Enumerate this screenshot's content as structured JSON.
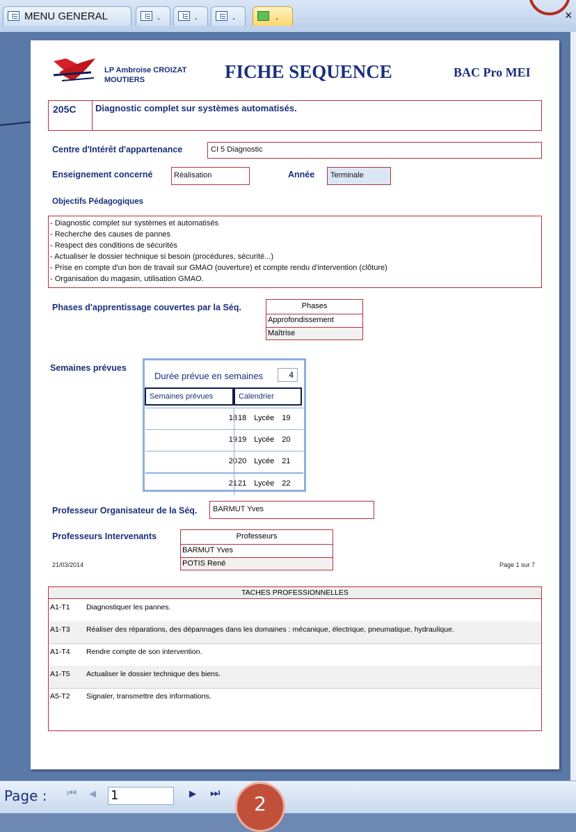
{
  "tabs": [
    {
      "label": "MENU GENERAL",
      "icon": "form-icon"
    },
    {
      "label": ".",
      "icon": "form-icon"
    },
    {
      "label": ".",
      "icon": "form-icon"
    },
    {
      "label": ".",
      "icon": "form-icon"
    },
    {
      "label": ".",
      "icon": "report-icon"
    }
  ],
  "close_glyph": "×",
  "report": {
    "school": "LP Ambroise CROIZAT",
    "town": "MOUTIERS",
    "title": "FICHE SEQUENCE",
    "diploma": "BAC Pro MEI",
    "seq_code": "205C",
    "seq_title": "Diagnostic complet sur systèmes automatisés.",
    "centre_label": "Centre d'Intérêt d'appartenance",
    "centre_value": "CI 5   Diagnostic",
    "enseignement_label": "Enseignement concerné",
    "enseignement_value": "Réalisation",
    "annee_label": "Année",
    "annee_value": "Terminale",
    "objectifs_label": "Objectifs Pédagogiques",
    "objectifs": [
      "- Diagnostic complet sur systèmes et automatisés",
      "- Recherche des causes de pannes",
      "- Respect des conditions de sécurités",
      "- Actualiser le dossier technique si besoin (procédures, sécurité...)",
      "- Prise en compte d'un bon de travail sur GMAO (ouverture) et compte rendu d'intervention (clôture)",
      "- Organisation du magasin, utilisation GMAO."
    ],
    "phases_label": "Phases d'apprentissage couvertes par la Séq.",
    "phases_header": "Phases",
    "phases": [
      "Approfondissement",
      "Maîtrise"
    ],
    "semaines_label": "Semaines prévues",
    "duree_label": "Durée prévue en semaines",
    "duree_value": "4",
    "weeks_col1": "Semaines prévues",
    "weeks_col2": "Calendrier",
    "weeks": [
      {
        "num": "18",
        "cal": "18  Lycée  19"
      },
      {
        "num": "19",
        "cal": "19  Lycée  20"
      },
      {
        "num": "20",
        "cal": "20  Lycée  21"
      },
      {
        "num": "21",
        "cal": "21  Lycée  22"
      }
    ],
    "prof_org_label": "Professeur Organisateur de la Séq.",
    "prof_org_value": "BARMUT Yves",
    "prof_int_label": "Professeurs Intervenants",
    "profs_header": "Professeurs",
    "profs": [
      "BARMUT Yves",
      "POTIS René"
    ],
    "tasks_header": "TACHES PROFESSIONNELLES",
    "tasks": [
      {
        "code": "A1-T1",
        "text": "Diagnostiquer les pannes."
      },
      {
        "code": "A1-T3",
        "text": "Réaliser des réparations, des dépannages dans les domaines : mécanique, électrique, pneumatique, hydraulique."
      },
      {
        "code": "A1-T4",
        "text": "Rendre compte de son intervention."
      },
      {
        "code": "A1-T5",
        "text": "Actualiser le dossier technique des biens."
      },
      {
        "code": "A5-T2",
        "text": "Signaler, transmettre des informations."
      }
    ],
    "date": "21/03/2014",
    "page_of": "Page 1 sur 7"
  },
  "nav": {
    "page_label": "Page :",
    "page_value": "1",
    "first_glyph": "⏮",
    "prev_glyph": "◀",
    "next_glyph": "▶",
    "last_glyph": "⏭"
  },
  "annotation_marker": "2",
  "colors": {
    "accent": "#b4313b",
    "text_blue": "#1a2f7a",
    "marker": "#c0503a"
  }
}
